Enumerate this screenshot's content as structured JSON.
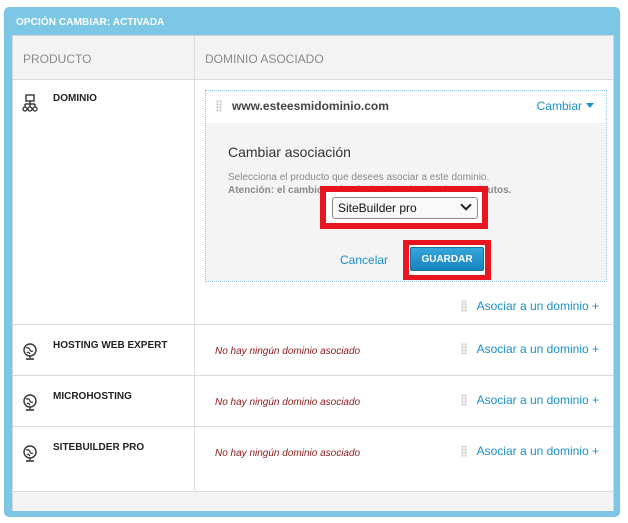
{
  "header": {
    "title": "OPCIÓN CAMBIAR: ACTIVADA"
  },
  "table": {
    "col_product": "PRODUCTO",
    "col_domain": "DOMINIO ASOCIADO"
  },
  "rows": [
    {
      "product": "DOMINIO",
      "icon": "network-icon",
      "domain": "www.esteesmidominio.com",
      "change_label": "Cambiar",
      "change_panel": {
        "title": "Cambiar asociación",
        "description": "Selecciona el producto que desees asociar a este dominio.",
        "warning": "Atención: el cambio se hará efectivo al cabo de 10 minutos.",
        "selected_product": "SiteBuilder pro",
        "cancel_label": "Cancelar",
        "save_label": "GUARDAR"
      },
      "add_label": "Asociar a un dominio +"
    },
    {
      "product": "HOSTING WEB EXPERT",
      "icon": "globe-icon",
      "status": "No hay ningún dominio asociado",
      "add_label": "Asociar a un dominio +"
    },
    {
      "product": "MICROHOSTING",
      "icon": "globe-icon",
      "status": "No hay ningún dominio asociado",
      "add_label": "Asociar a un dominio +"
    },
    {
      "product": "SITEBUILDER PRO",
      "icon": "globe-icon",
      "status": "No hay ningún dominio asociado",
      "add_label": "Asociar a un dominio +"
    }
  ],
  "colors": {
    "panel": "#7cc7e6",
    "link": "#1a8fc9",
    "highlight": "#e8141e",
    "no_domain": "#8b1a1a"
  }
}
